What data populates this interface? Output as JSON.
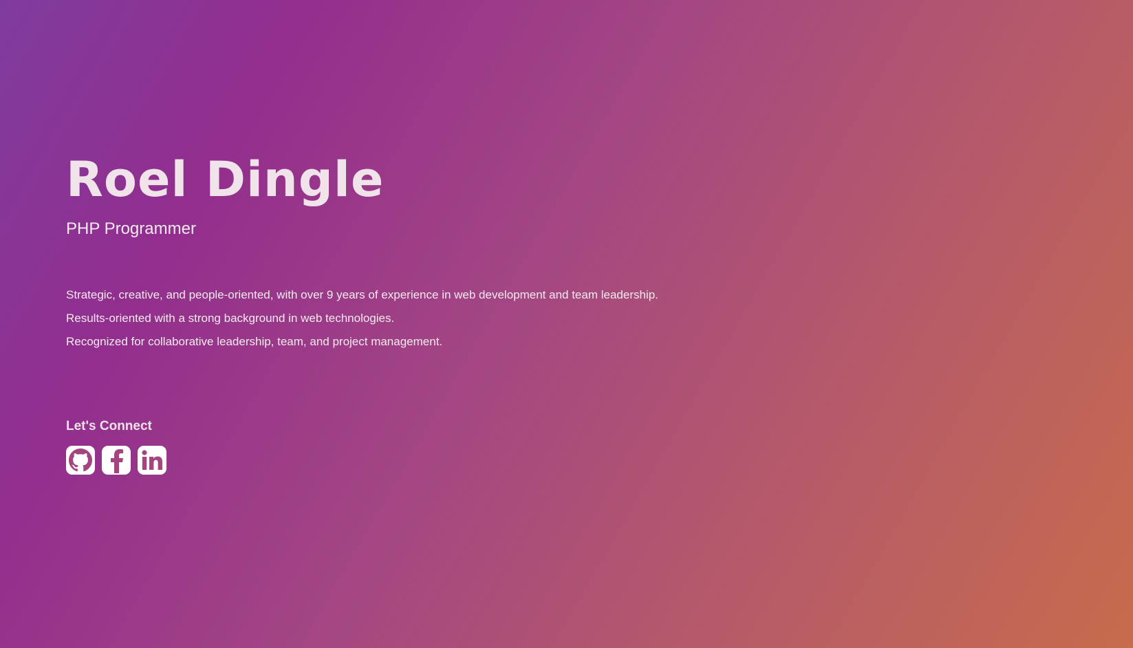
{
  "profile": {
    "name": "Roel Dingle",
    "role": "PHP Programmer"
  },
  "bio": {
    "lines": [
      "Strategic, creative, and people-oriented, with over 9 years of experience in web development and team leadership.",
      "Results-oriented with a strong background in web technologies.",
      "Recognized for collaborative leadership, team, and project management."
    ]
  },
  "connect": {
    "heading": "Let's Connect",
    "links": [
      {
        "icon": "github-icon"
      },
      {
        "icon": "facebook-icon"
      },
      {
        "icon": "linkedin-icon"
      }
    ]
  },
  "colors": {
    "background_start": "#7f3c9e",
    "background_end": "#c76c4c",
    "text": "#f4eaee",
    "icon_tile": "#ffffff"
  }
}
